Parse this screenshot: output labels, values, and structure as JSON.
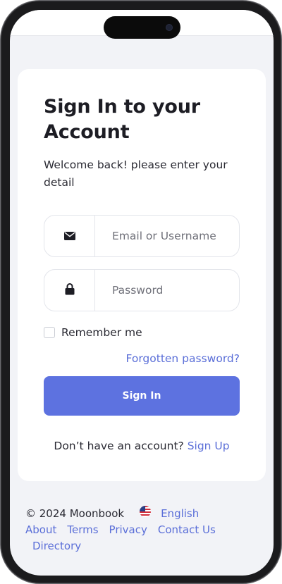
{
  "login": {
    "title": "Sign In to your Account",
    "subtitle": "Welcome back! please enter your detail",
    "email_placeholder": "Email or Username",
    "password_placeholder": "Password",
    "remember_label": "Remember me",
    "forgot_label": "Forgotten password?",
    "signin_label": "Sign In",
    "signup_prompt": "Don’t have an account?",
    "signup_label": "Sign Up"
  },
  "icons": {
    "email": "envelope-icon",
    "password": "lock-icon",
    "language": "us-flag-icon"
  },
  "footer": {
    "copyright": "© 2024 Moonbook",
    "language": "English",
    "links": [
      "About",
      "Terms",
      "Privacy",
      "Contact Us",
      "Directory"
    ]
  },
  "colors": {
    "accent": "#5d72e0",
    "link": "#5b6fd8",
    "background": "#f2f3f7",
    "text": "#1d1d24"
  }
}
